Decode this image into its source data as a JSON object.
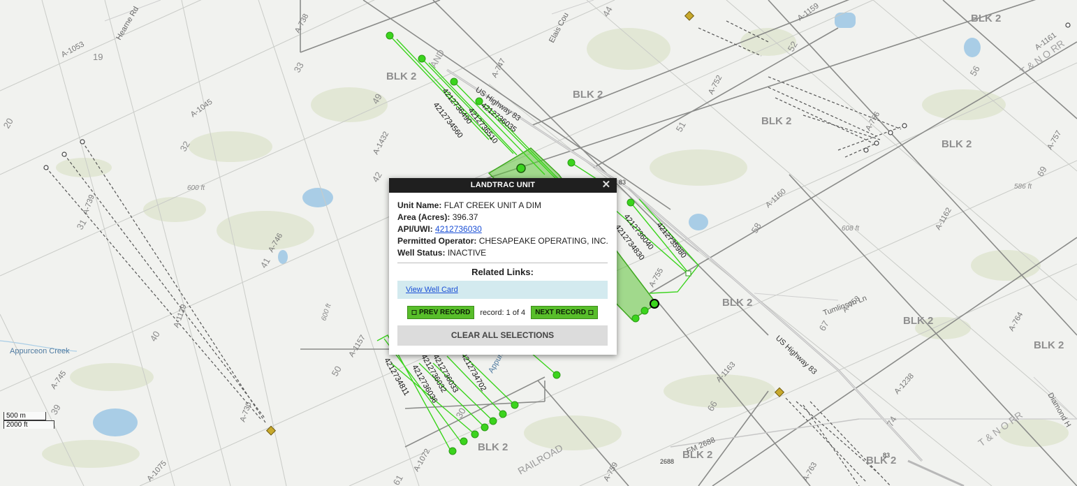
{
  "popup": {
    "title": "LANDTRAC UNIT",
    "close_symbol": "✕",
    "unit_name_label": "Unit Name:",
    "unit_name": "FLAT CREEK UNIT A DIM",
    "area_label": "Area (Acres):",
    "area": "396.37",
    "api_label": "API/UWI:",
    "api": "4212736030",
    "operator_label": "Permitted Operator:",
    "operator": "CHESAPEAKE OPERATING, INC.",
    "status_label": "Well Status:",
    "status": "INACTIVE",
    "related_links_title": "Related Links:",
    "view_well_card": "View Well Card",
    "prev_label": "◻ PREV RECORD",
    "record_count": "record: 1 of 4",
    "next_label": "NEXT RECORD ◻",
    "clear_label": "CLEAR ALL SELECTIONS"
  },
  "scale": {
    "metric": "500 m",
    "imperial": "2000 ft"
  },
  "map": {
    "block_labels": [
      "BLK 2",
      "BLK 2",
      "BLK 2",
      "BLK 2",
      "BLK 2",
      "BLK 2",
      "BLK 2",
      "BLK 2",
      "BLK 2",
      "BLK 2",
      "BLK 2"
    ],
    "abstract_labels": [
      "A-738",
      "A-1053",
      "A-1045",
      "A-1432",
      "A-747",
      "A-752",
      "A-1159",
      "A-1161",
      "A-756",
      "A-757",
      "A-1160",
      "A-1162",
      "A-758",
      "A-764",
      "A-746",
      "A-739",
      "A-1129",
      "A-1157",
      "A-745",
      "A-1072",
      "A-1075",
      "A-1163",
      "A-1238",
      "A-763",
      "A-759",
      "A-730",
      "A-755"
    ],
    "section_numbers": [
      "19",
      "20",
      "31",
      "33",
      "32",
      "42",
      "41",
      "40",
      "50",
      "39",
      "44",
      "52",
      "51",
      "56",
      "69",
      "58",
      "67",
      "66",
      "74",
      "61",
      "49",
      "30"
    ],
    "road_labels": [
      "Hearne Rd",
      "Elais Cou",
      "US Highway 83",
      "Tumlinson Ln",
      "US Highway 83",
      "FM 2688",
      "Diamond H",
      "RAILROAD",
      "AND",
      "T & N O RR",
      "T & N O RR",
      "2688",
      "83",
      "83"
    ],
    "elevation_labels": [
      "600 ft",
      "586 ft",
      "608 ft",
      "600 ft"
    ],
    "water_labels": [
      "Appurceon Creek",
      "Appurce"
    ],
    "well_apis": [
      "4212736490",
      "4212736510",
      "4212736035",
      "4212734560",
      "4212735980",
      "4212734830",
      "4212736040",
      "4212734811",
      "4212736036",
      "4212736033",
      "4212736032",
      "4212734702"
    ]
  }
}
